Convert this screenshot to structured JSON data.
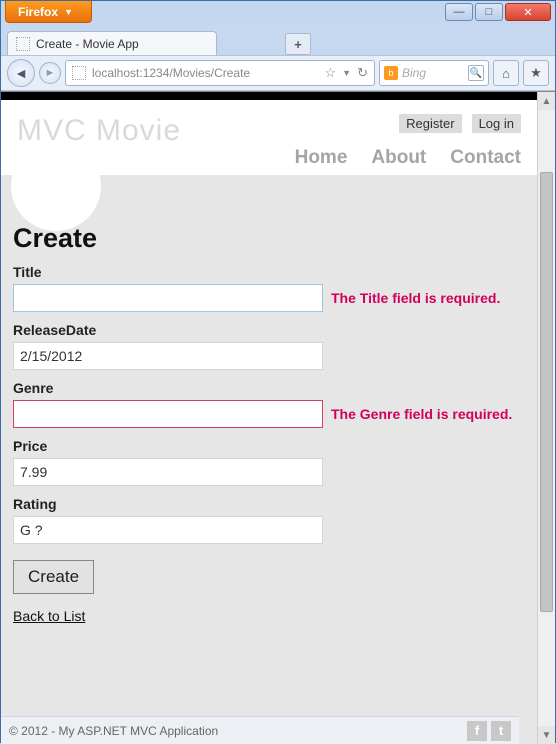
{
  "browser": {
    "name": "Firefox",
    "tab_title": "Create - Movie App",
    "url": "localhost:1234/Movies/Create",
    "search_engine": "Bing"
  },
  "header": {
    "logo": "MVC Movie",
    "auth": {
      "register": "Register",
      "login": "Log in"
    },
    "nav": [
      "Home",
      "About",
      "Contact"
    ]
  },
  "page": {
    "heading": "Create",
    "fields": {
      "title": {
        "label": "Title",
        "value": "",
        "error": "The Title field is required."
      },
      "releaseDate": {
        "label": "ReleaseDate",
        "value": "2/15/2012",
        "error": ""
      },
      "genre": {
        "label": "Genre",
        "value": "",
        "error": "The Genre field is required."
      },
      "price": {
        "label": "Price",
        "value": "7.99",
        "error": ""
      },
      "rating": {
        "label": "Rating",
        "value": "G ?",
        "error": ""
      }
    },
    "submit": "Create",
    "back": "Back to List"
  },
  "footer": {
    "text": "© 2012 - My ASP.NET MVC Application"
  }
}
